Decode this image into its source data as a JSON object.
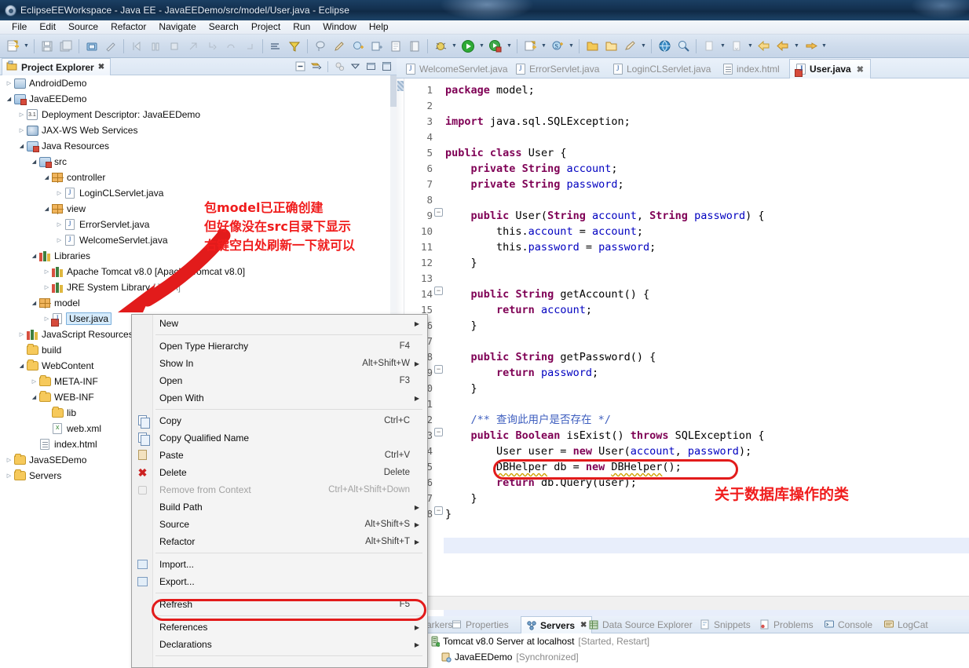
{
  "window": {
    "title": "EclipseEEWorkspace - Java EE - JavaEEDemo/src/model/User.java - Eclipse",
    "icon": "eclipse-icon"
  },
  "menubar": {
    "items": [
      {
        "label": "File"
      },
      {
        "label": "Edit"
      },
      {
        "label": "Source"
      },
      {
        "label": "Refactor"
      },
      {
        "label": "Navigate"
      },
      {
        "label": "Search"
      },
      {
        "label": "Project"
      },
      {
        "label": "Run"
      },
      {
        "label": "Window"
      },
      {
        "label": "Help"
      }
    ]
  },
  "project_explorer": {
    "tab_label": "Project Explorer",
    "tab_close": "✖",
    "toolbar_icons": [
      "collapse-all-icon",
      "link-with-editor-icon",
      "focus-on-active-task-icon",
      "view-menu-icon",
      "minimize-icon",
      "maximize-icon"
    ],
    "tree": [
      {
        "indent": 0,
        "twist": "collapsed",
        "icon": "android-project-icon",
        "label": "AndroidDemo",
        "sub": ""
      },
      {
        "indent": 0,
        "twist": "expanded",
        "icon": "javaee-project-icon",
        "label": "JavaEEDemo",
        "sub": ""
      },
      {
        "indent": 1,
        "twist": "collapsed",
        "icon": "deployment-descriptor-icon",
        "label": "Deployment Descriptor: JavaEEDemo",
        "sub": ""
      },
      {
        "indent": 1,
        "twist": "collapsed",
        "icon": "web-services-icon",
        "label": "JAX-WS Web Services",
        "sub": ""
      },
      {
        "indent": 1,
        "twist": "expanded",
        "icon": "java-resources-icon",
        "label": "Java Resources",
        "sub": ""
      },
      {
        "indent": 2,
        "twist": "expanded",
        "icon": "source-folder-icon",
        "label": "src",
        "sub": ""
      },
      {
        "indent": 3,
        "twist": "expanded",
        "icon": "package-icon",
        "label": "controller",
        "sub": ""
      },
      {
        "indent": 4,
        "twist": "collapsed",
        "icon": "java-file-icon",
        "label": "LoginCLServlet.java",
        "sub": ""
      },
      {
        "indent": 3,
        "twist": "expanded",
        "icon": "package-icon",
        "label": "view",
        "sub": ""
      },
      {
        "indent": 4,
        "twist": "collapsed",
        "icon": "java-file-icon",
        "label": "ErrorServlet.java",
        "sub": ""
      },
      {
        "indent": 4,
        "twist": "collapsed",
        "icon": "java-file-icon",
        "label": "WelcomeServlet.java",
        "sub": ""
      },
      {
        "indent": 2,
        "twist": "expanded",
        "icon": "libraries-icon",
        "label": "Libraries",
        "sub": ""
      },
      {
        "indent": 3,
        "twist": "collapsed",
        "icon": "libraries-icon",
        "label": "Apache Tomcat v8.0 [Apache Tomcat v8.0]",
        "sub": ""
      },
      {
        "indent": 3,
        "twist": "collapsed",
        "icon": "libraries-icon",
        "label": "JRE System Library",
        "sub": "[JAVA]"
      },
      {
        "indent": 2,
        "twist": "expanded",
        "icon": "package-icon",
        "label": "model",
        "sub": ""
      },
      {
        "indent": 3,
        "twist": "collapsed",
        "icon": "java-file-error-icon",
        "label": "User.java",
        "sub": "",
        "selected": true
      },
      {
        "indent": 1,
        "twist": "collapsed",
        "icon": "libraries-icon",
        "label": "JavaScript Resources",
        "sub": ""
      },
      {
        "indent": 1,
        "twist": "none",
        "icon": "folder-icon",
        "label": "build",
        "sub": ""
      },
      {
        "indent": 1,
        "twist": "expanded",
        "icon": "folder-icon",
        "label": "WebContent",
        "sub": ""
      },
      {
        "indent": 2,
        "twist": "collapsed",
        "icon": "folder-icon",
        "label": "META-INF",
        "sub": ""
      },
      {
        "indent": 2,
        "twist": "expanded",
        "icon": "folder-icon",
        "label": "WEB-INF",
        "sub": ""
      },
      {
        "indent": 3,
        "twist": "none",
        "icon": "folder-icon",
        "label": "lib",
        "sub": ""
      },
      {
        "indent": 3,
        "twist": "none",
        "icon": "xml-file-icon",
        "label": "web.xml",
        "sub": ""
      },
      {
        "indent": 2,
        "twist": "none",
        "icon": "html-file-icon",
        "label": "index.html",
        "sub": ""
      },
      {
        "indent": 0,
        "twist": "collapsed",
        "icon": "project-icon",
        "label": "JavaSEDemo",
        "sub": ""
      },
      {
        "indent": 0,
        "twist": "collapsed",
        "icon": "folder-icon",
        "label": "Servers",
        "sub": ""
      }
    ]
  },
  "context_menu": {
    "items": [
      {
        "label": "New",
        "accel": "",
        "arrow": true,
        "icon": "",
        "disabled": false
      },
      {
        "sep": true
      },
      {
        "label": "Open Type Hierarchy",
        "accel": "F4",
        "arrow": false,
        "icon": "",
        "disabled": false
      },
      {
        "label": "Show In",
        "accel": "Alt+Shift+W",
        "arrow": true,
        "icon": "",
        "disabled": false
      },
      {
        "label": "Open",
        "accel": "F3",
        "arrow": false,
        "icon": "",
        "disabled": false
      },
      {
        "label": "Open With",
        "accel": "",
        "arrow": true,
        "icon": "",
        "disabled": false
      },
      {
        "sep": true
      },
      {
        "label": "Copy",
        "accel": "Ctrl+C",
        "arrow": false,
        "icon": "copy-icon",
        "disabled": false
      },
      {
        "label": "Copy Qualified Name",
        "accel": "",
        "arrow": false,
        "icon": "copy-qualified-icon",
        "disabled": false
      },
      {
        "label": "Paste",
        "accel": "Ctrl+V",
        "arrow": false,
        "icon": "paste-icon",
        "disabled": false
      },
      {
        "label": "Delete",
        "accel": "Delete",
        "arrow": false,
        "icon": "delete-icon",
        "disabled": false
      },
      {
        "label": "Remove from Context",
        "accel": "Ctrl+Alt+Shift+Down",
        "arrow": false,
        "icon": "remove-context-icon",
        "disabled": true
      },
      {
        "label": "Build Path",
        "accel": "",
        "arrow": true,
        "icon": "",
        "disabled": false
      },
      {
        "label": "Source",
        "accel": "Alt+Shift+S",
        "arrow": true,
        "icon": "",
        "disabled": false
      },
      {
        "label": "Refactor",
        "accel": "Alt+Shift+T",
        "arrow": true,
        "icon": "",
        "disabled": false
      },
      {
        "sep": true
      },
      {
        "label": "Import...",
        "accel": "",
        "arrow": false,
        "icon": "import-icon",
        "disabled": false
      },
      {
        "label": "Export...",
        "accel": "",
        "arrow": false,
        "icon": "export-icon",
        "disabled": false
      },
      {
        "sep": true
      },
      {
        "label": "Refresh",
        "accel": "F5",
        "arrow": false,
        "icon": "",
        "disabled": false,
        "highlighted": true
      },
      {
        "sep": true
      },
      {
        "label": "References",
        "accel": "",
        "arrow": true,
        "icon": "",
        "disabled": false
      },
      {
        "label": "Declarations",
        "accel": "",
        "arrow": true,
        "icon": "",
        "disabled": false
      },
      {
        "sep": true
      }
    ]
  },
  "editor": {
    "tabs": [
      {
        "label": "WelcomeServlet.java",
        "icon": "java-file-icon",
        "active": false
      },
      {
        "label": "ErrorServlet.java",
        "icon": "java-file-icon",
        "active": false
      },
      {
        "label": "LoginCLServlet.java",
        "icon": "java-file-icon",
        "active": false
      },
      {
        "label": "index.html",
        "icon": "html-file-icon",
        "active": false
      },
      {
        "label": "User.java",
        "icon": "java-file-error-icon",
        "active": true,
        "close": "✖"
      }
    ],
    "line_numbers": [
      "1",
      "2",
      "3",
      "4",
      "5",
      "6",
      "7",
      "8",
      "9",
      "10",
      "11",
      "12",
      "13",
      "14",
      "15",
      "16",
      "17",
      "18",
      "19",
      "20",
      "21",
      "22",
      "23",
      "24",
      "25",
      "26",
      "27",
      "28"
    ],
    "code_lines": [
      "package model;",
      "",
      "import java.sql.SQLException;",
      "",
      "public class User {",
      "    private String account;",
      "    private String password;",
      "",
      "    public User(String account, String password) {",
      "        this.account = account;",
      "        this.password = password;",
      "    }",
      "",
      "    public String getAccount() {",
      "        return account;",
      "    }",
      "",
      "    public String getPassword() {",
      "        return password;",
      "    }",
      "",
      "    /** 查询此用户是否存在 */",
      "    public Boolean isExist() throws SQLException {",
      "        User user = new User(account, password);",
      "        DBHelper db = new DBHelper();",
      "        return db.Query(user);",
      "    }",
      "}"
    ]
  },
  "bottom_panel": {
    "tabs": [
      {
        "label": "Markers",
        "icon": "markers-icon",
        "active": false
      },
      {
        "label": "Properties",
        "icon": "properties-icon",
        "active": false
      },
      {
        "label": "Servers",
        "icon": "servers-icon",
        "active": true,
        "close": "✖"
      },
      {
        "label": "Data Source Explorer",
        "icon": "data-source-icon",
        "active": false
      },
      {
        "label": "Snippets",
        "icon": "snippets-icon",
        "active": false
      },
      {
        "label": "Problems",
        "icon": "problems-icon",
        "active": false
      },
      {
        "label": "Console",
        "icon": "console-icon",
        "active": false
      },
      {
        "label": "LogCat",
        "icon": "logcat-icon",
        "active": false
      }
    ],
    "rows": [
      {
        "indent": 0,
        "icon": "server-icon",
        "label": "Tomcat v8.0 Server at localhost",
        "status": "[Started, Restart]"
      },
      {
        "indent": 1,
        "icon": "module-icon",
        "label": "JavaEEDemo",
        "status": "[Synchronized]"
      }
    ]
  },
  "annotations": {
    "left": [
      "包model已正确创建",
      "但好像没在src目录下显示",
      "右键空白处刷新一下就可以"
    ],
    "right": "关于数据库操作的类",
    "color": "#f01d1d"
  },
  "colors": {
    "title_bar": "#13304f",
    "toolbar": "#cfdcec",
    "accent_red": "#e21b1b",
    "selection_blue": "#d6ebfb",
    "keyword_purple": "#7f0055",
    "field_blue": "#0000c0",
    "comment_blue": "#3f5fbf"
  }
}
